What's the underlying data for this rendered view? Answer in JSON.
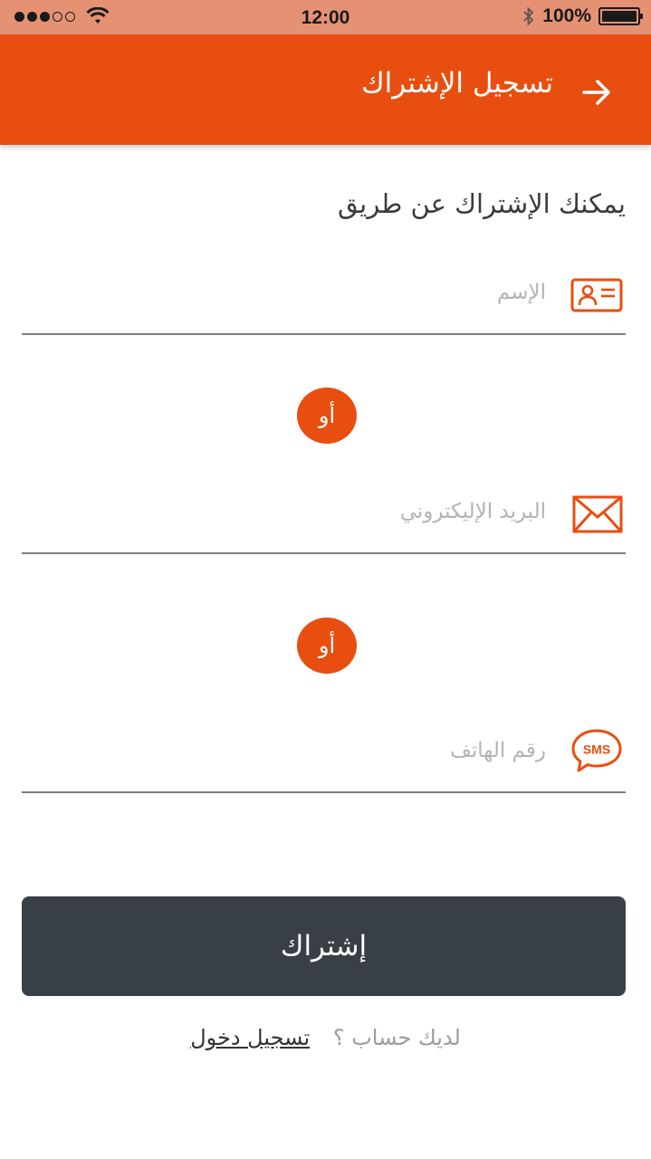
{
  "status_bar": {
    "time": "12:00",
    "battery": "100%",
    "signal_bars": 3,
    "signal_max": 5
  },
  "header": {
    "title": "تسجيل الإشتراك",
    "back_icon": "arrow-right-icon",
    "color": "#e84e0f"
  },
  "form": {
    "intro": "يمكنك الإشتراك عن طريق",
    "name_field": {
      "placeholder": "الإسم",
      "value": "",
      "icon": "id-card-icon"
    },
    "or_label": "أو",
    "email_field": {
      "placeholder": "البريد الإليكتروني",
      "value": "",
      "icon": "envelope-icon"
    },
    "phone_field": {
      "placeholder": "رقم الهاتف",
      "value": "",
      "icon": "sms-icon",
      "icon_text": "SMS"
    },
    "submit_label": "إشتراك"
  },
  "footer": {
    "question": "لديك حساب ؟",
    "login_link": "تسجيل دخول"
  },
  "colors": {
    "accent": "#e84e0f",
    "button": "#393f47",
    "status_bar": "#e59274"
  }
}
